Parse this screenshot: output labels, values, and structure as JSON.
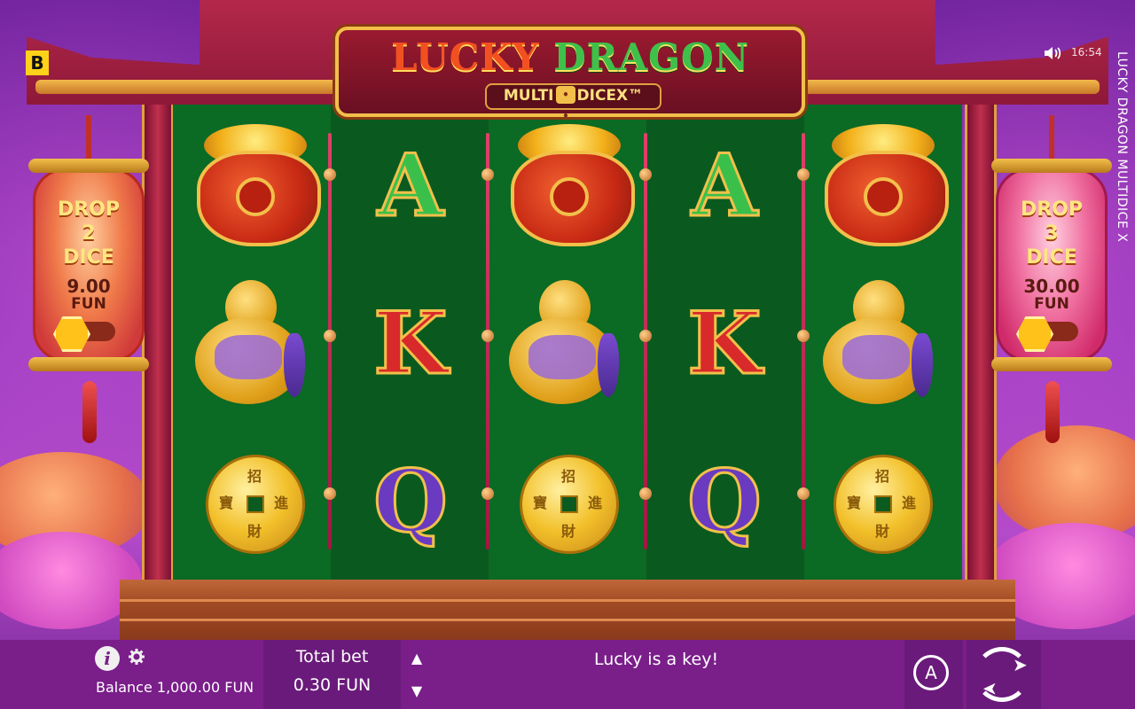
{
  "game": {
    "title_word1": "LUCKY",
    "title_word2": "DRAGON",
    "subtitle_left": "MULTI",
    "subtitle_right": "DICE",
    "subtitle_x": "X™",
    "side_title": "LUCKY DRAGON MULTIDICE X"
  },
  "topbar": {
    "brand_badge": "B",
    "volume_icon": "speaker-icon",
    "clock": "16:54"
  },
  "lanterns": {
    "left": {
      "line1": "DROP",
      "line2": "2",
      "line3": "DICE",
      "value": "9.00",
      "unit": "FUN"
    },
    "right": {
      "line1": "DROP",
      "line2": "3",
      "line3": "DICE",
      "value": "30.00",
      "unit": "FUN"
    }
  },
  "reels": [
    [
      "gold-pot",
      "gourd",
      "coin"
    ],
    [
      "A",
      "K",
      "Q"
    ],
    [
      "gold-pot",
      "gourd",
      "coin"
    ],
    [
      "A",
      "K",
      "Q"
    ],
    [
      "gold-pot",
      "gourd",
      "coin"
    ]
  ],
  "symbols": {
    "letter_a": "A",
    "letter_k": "K",
    "letter_q": "Q",
    "coin_glyphs": [
      "招",
      "進",
      "寶",
      "財"
    ]
  },
  "bottombar": {
    "info_icon": "i",
    "balance": "Balance 1,000.00 FUN",
    "total_bet_label": "Total bet",
    "total_bet_value": "0.30 FUN",
    "bet_up": "▲",
    "bet_down": "▼",
    "message": "Lucky is a key!",
    "auto_label": "A"
  },
  "colors": {
    "reel_green": "#0b6a24",
    "bar_purple": "#7a1e8a",
    "frame_red": "#b3284a",
    "gold": "#f2c04a"
  }
}
